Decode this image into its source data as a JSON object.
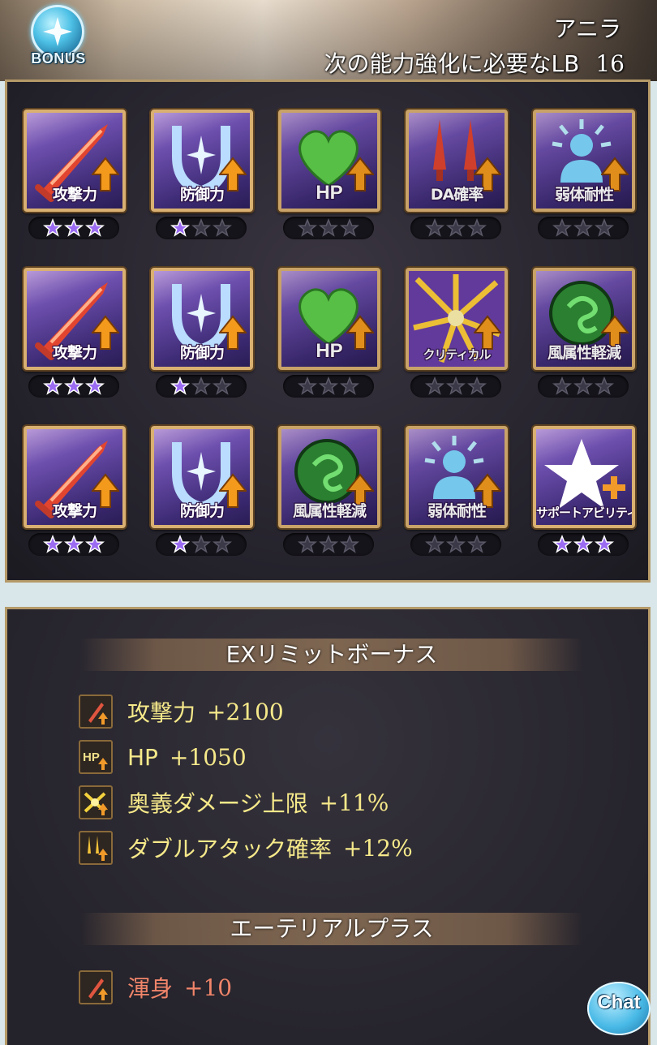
{
  "header": {
    "bonus_label": "BONUS",
    "character_name": "アニラ",
    "lb_text": "次の能力強化に必要なLB",
    "lb_value": "16"
  },
  "skills": [
    {
      "label": "攻撃力",
      "art": "sword-icon",
      "stars": 3
    },
    {
      "label": "防御力",
      "art": "shield-icon",
      "stars": 1
    },
    {
      "label": "HP",
      "art": "heart-icon",
      "stars": 0
    },
    {
      "label": "DA確率",
      "art": "double-sword-icon",
      "stars": 0
    },
    {
      "label": "弱体耐性",
      "art": "debuff-resist-icon",
      "stars": 0
    },
    {
      "label": "攻撃力",
      "art": "sword-icon",
      "stars": 3
    },
    {
      "label": "防御力",
      "art": "shield-icon",
      "stars": 1
    },
    {
      "label": "HP",
      "art": "heart-icon",
      "stars": 0
    },
    {
      "label": "クリティカル",
      "art": "critical-icon",
      "stars": 0
    },
    {
      "label": "風属性軽減",
      "art": "wind-orb-icon",
      "stars": 0
    },
    {
      "label": "攻撃力",
      "art": "sword-icon",
      "stars": 3
    },
    {
      "label": "防御力",
      "art": "shield-icon",
      "stars": 1
    },
    {
      "label": "風属性軽減",
      "art": "wind-orb-icon",
      "stars": 0
    },
    {
      "label": "弱体耐性",
      "art": "debuff-resist-icon",
      "stars": 0
    },
    {
      "label": "サポートアビリティ",
      "art": "support-star-icon",
      "stars": 3
    }
  ],
  "ex_limit": {
    "title": "EXリミットボーナス",
    "items": [
      {
        "name": "攻撃力",
        "value": "+2100"
      },
      {
        "name": "HP",
        "value": "+1050"
      },
      {
        "name": "奥義ダメージ上限",
        "value": "+11%"
      },
      {
        "name": "ダブルアタック確率",
        "value": "+12%"
      }
    ]
  },
  "aetherial": {
    "title": "エーテリアルプラス",
    "items": [
      {
        "name": "渾身",
        "value": "+10"
      }
    ]
  },
  "chat": {
    "label": "Chat"
  },
  "colors": {
    "gold_border": "#d9b071",
    "stat_text": "#f6e98a",
    "aetherial_text": "#f0856a",
    "star_active": "#9b6cf2"
  }
}
